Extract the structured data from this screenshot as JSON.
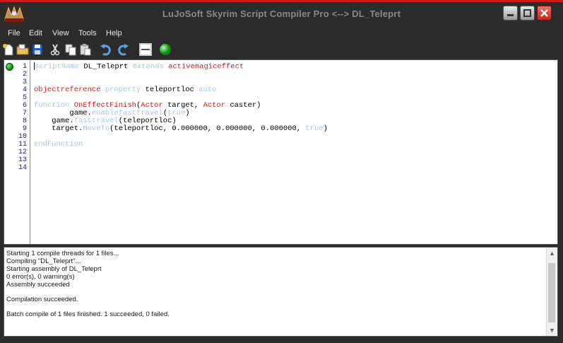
{
  "window": {
    "title": "LuJoSoft Skyrim Script Compiler Pro <--> DL_Teleprt"
  },
  "menu": {
    "items": [
      "File",
      "Edit",
      "View",
      "Tools",
      "Help"
    ]
  },
  "toolbar": {
    "icons": [
      "new-file-icon",
      "open-folder-icon",
      "save-icon",
      "cut-icon",
      "copy-icon",
      "paste-icon",
      "undo-icon",
      "redo-icon",
      "toggle-panel-icon",
      "compile-icon"
    ]
  },
  "colors": {
    "accent_red": "#d01818",
    "keyword_blue": "#a8c8e8",
    "keyword_red": "#d02020",
    "line_number": "#1a1a9a",
    "breakpoint_green": "#0a7a0a"
  },
  "editor": {
    "line_numbers": [
      "1",
      "2",
      "3",
      "4",
      "5",
      "6",
      "7",
      "8",
      "9",
      "10",
      "11",
      "12",
      "13",
      "14"
    ],
    "lines": [
      {
        "kw1": "scriptName",
        "t1": " DL_Teleprt ",
        "kw2": "extends",
        "t2": " ",
        "kr1": "activemagiceffect"
      },
      {},
      {},
      {
        "kr1": "objectreference",
        "t1": " ",
        "kw1": "property",
        "t2": " teleportloc ",
        "kw2": "auto"
      },
      {},
      {
        "kw1": "function",
        "t1": " ",
        "kr1": "OnEffectFinish",
        "t2": "(",
        "kr2": "Actor",
        "t3": " target, ",
        "kr3": "Actor",
        "t4": " caster)"
      },
      {
        "t1": "        game.",
        "kw1": "enablefasttravel",
        "t2": "(",
        "kw2": "true",
        "t3": ")"
      },
      {
        "t1": "    game.",
        "kw1": "fasttravel",
        "t2": "(teleportloc)"
      },
      {
        "t1": "    target.",
        "kw1": "MoveTo",
        "t2": "(teleportloc, 0.000000, 0.000000, 0.000000, ",
        "kw2": "true",
        "t3": ")"
      },
      {},
      {
        "kw1": "endFunction"
      },
      {},
      {},
      {}
    ]
  },
  "output": {
    "lines": [
      "Starting 1 compile threads for 1 files...",
      "Compiling \"DL_Teleprt\"...",
      "Starting assembly of DL_Teleprt",
      "0 error(s), 0 warning(s)",
      "Assembly succeeded",
      "",
      "Compilation succeeded.",
      "",
      "Batch compile of 1 files finished. 1 succeeded, 0 failed."
    ]
  }
}
